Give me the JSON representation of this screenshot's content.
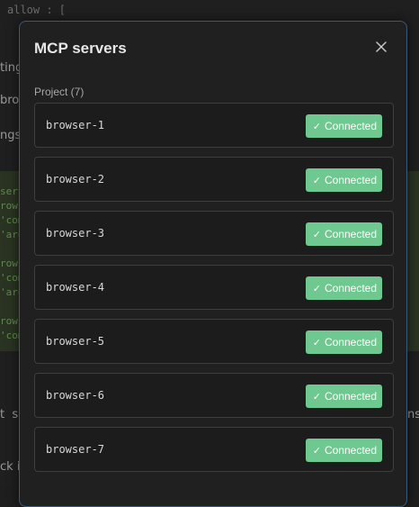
{
  "background": {
    "top_line": "allow : [",
    "left_fragments": [
      "ting",
      "bro",
      "ngs"
    ],
    "code_lines": [
      "serv",
      "rows",
      "'com",
      "'arg",
      "",
      "rows",
      "'com",
      "'arg",
      "",
      "rows",
      "'com"
    ],
    "bottom_fragments": [
      "t  se",
      "ck i",
      "ns"
    ]
  },
  "modal": {
    "title": "MCP servers",
    "close_label": "×",
    "section_label": "Project (7)",
    "servers": [
      {
        "name": "browser-1",
        "status": "Connected"
      },
      {
        "name": "browser-2",
        "status": "Connected"
      },
      {
        "name": "browser-3",
        "status": "Connected"
      },
      {
        "name": "browser-4",
        "status": "Connected"
      },
      {
        "name": "browser-5",
        "status": "Connected"
      },
      {
        "name": "browser-6",
        "status": "Connected"
      },
      {
        "name": "browser-7",
        "status": "Connected"
      }
    ],
    "status_icon": "check-icon",
    "colors": {
      "badge": "#6ec890",
      "border": "#3a5a78"
    }
  }
}
